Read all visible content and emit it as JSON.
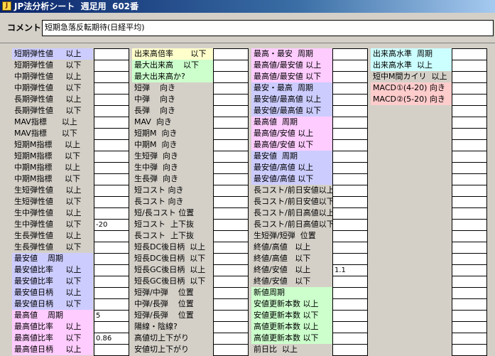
{
  "window": {
    "title": "JP法分析シート  週足用  602番"
  },
  "comment": {
    "label": "コメント",
    "value": "短期急落反転期待(日経平均)"
  },
  "columns": [
    {
      "rows": [
        {
          "label": "短期弾性値     以上",
          "value": "",
          "bg": "#ccccff"
        },
        {
          "label": "短期弾性値     以下",
          "value": "",
          "bg": ""
        },
        {
          "label": "中期弾性値     以上",
          "value": "",
          "bg": ""
        },
        {
          "label": "中期弾性値     以下",
          "value": "",
          "bg": ""
        },
        {
          "label": "長期弾性値     以上",
          "value": "",
          "bg": ""
        },
        {
          "label": "長期弾性値     以下",
          "value": "",
          "bg": ""
        },
        {
          "label": "MAV指標      以上",
          "value": "",
          "bg": ""
        },
        {
          "label": "MAV指標      以下",
          "value": "",
          "bg": ""
        },
        {
          "label": "短期M指標     以上",
          "value": "",
          "bg": ""
        },
        {
          "label": "短期M指標     以下",
          "value": "",
          "bg": ""
        },
        {
          "label": "中期M指標     以上",
          "value": "",
          "bg": ""
        },
        {
          "label": "中期M指標     以下",
          "value": "",
          "bg": ""
        },
        {
          "label": "生短弾性値     以上",
          "value": "",
          "bg": ""
        },
        {
          "label": "生短弾性値     以下",
          "value": "",
          "bg": ""
        },
        {
          "label": "生中弾性値     以上",
          "value": "",
          "bg": ""
        },
        {
          "label": "生中弾性値     以下",
          "value": "-20",
          "bg": ""
        },
        {
          "label": "生長弾性値     以上",
          "value": "",
          "bg": ""
        },
        {
          "label": "生長弾性値     以下",
          "value": "",
          "bg": ""
        },
        {
          "label": "最安値    周期",
          "value": "",
          "bg": "#ccccff"
        },
        {
          "label": "最安値比率     以上",
          "value": "",
          "bg": "#ccccff"
        },
        {
          "label": "最安値比率     以下",
          "value": "",
          "bg": "#ccccff"
        },
        {
          "label": "最安値日柄     以上",
          "value": "",
          "bg": "#ccccff"
        },
        {
          "label": "最安値日柄     以下",
          "value": "",
          "bg": "#ccccff"
        },
        {
          "label": "最高値    周期",
          "value": "5",
          "bg": "#ffccff"
        },
        {
          "label": "最高値比率     以上",
          "value": "",
          "bg": "#ffccff"
        },
        {
          "label": "最高値比率     以下",
          "value": "0.86",
          "bg": "#ffccff"
        },
        {
          "label": "最高値日柄     以上",
          "value": "",
          "bg": "#ffccff"
        }
      ]
    },
    {
      "rows": [
        {
          "label": "出来高倍率       以下",
          "value": "",
          "bg": "#ffffcc"
        },
        {
          "label": "最大出来高    以下",
          "value": "",
          "bg": "#ccffcc"
        },
        {
          "label": "最大出来高か?",
          "value": "",
          "bg": "#ccffcc"
        },
        {
          "label": "短弾    向き",
          "value": "",
          "bg": ""
        },
        {
          "label": "中弾    向き",
          "value": "",
          "bg": ""
        },
        {
          "label": "長弾    向き",
          "value": "",
          "bg": ""
        },
        {
          "label": "MAV  向き",
          "value": "",
          "bg": ""
        },
        {
          "label": "短期M  向き",
          "value": "",
          "bg": ""
        },
        {
          "label": "中期M  向き",
          "value": "",
          "bg": ""
        },
        {
          "label": "生短弾  向き",
          "value": "",
          "bg": ""
        },
        {
          "label": "生中弾  向き",
          "value": "",
          "bg": ""
        },
        {
          "label": "生長弾  向き",
          "value": "",
          "bg": ""
        },
        {
          "label": "短コスト 向き",
          "value": "",
          "bg": ""
        },
        {
          "label": "長コスト 向き",
          "value": "",
          "bg": ""
        },
        {
          "label": "短/長コスト 位置",
          "value": "",
          "bg": ""
        },
        {
          "label": "短コスト  上下抜",
          "value": "",
          "bg": ""
        },
        {
          "label": "長コスト  上下抜",
          "value": "",
          "bg": ""
        },
        {
          "label": "短長DC後日柄  以上",
          "value": "",
          "bg": ""
        },
        {
          "label": "短長DC後日柄  以下",
          "value": "",
          "bg": ""
        },
        {
          "label": "短長GC後日柄  以上",
          "value": "",
          "bg": ""
        },
        {
          "label": "短長GC後日柄  以下",
          "value": "",
          "bg": ""
        },
        {
          "label": "短弾/中弾    位置",
          "value": "",
          "bg": ""
        },
        {
          "label": "中弾/長弾    位置",
          "value": "",
          "bg": ""
        },
        {
          "label": "短弾/長弾    位置",
          "value": "",
          "bg": ""
        },
        {
          "label": "陽線・陰線?",
          "value": "",
          "bg": ""
        },
        {
          "label": "高値切上下がり",
          "value": "",
          "bg": ""
        },
        {
          "label": "安値切上下がり",
          "value": "",
          "bg": ""
        }
      ]
    },
    {
      "rows": [
        {
          "label": "最高・最安  周期",
          "value": "",
          "bg": "#ffccff"
        },
        {
          "label": "最高値/最安値 以上",
          "value": "",
          "bg": "#ffccff"
        },
        {
          "label": "最高値/最安値 以下",
          "value": "",
          "bg": "#ffccff"
        },
        {
          "label": "最安・最高  周期",
          "value": "",
          "bg": "#ccccff"
        },
        {
          "label": "最安値/最高値 以上",
          "value": "",
          "bg": "#ccccff"
        },
        {
          "label": "最安値/最高値 以下",
          "value": "",
          "bg": "#ccccff"
        },
        {
          "label": "最高値  周期",
          "value": "",
          "bg": "#ffccff"
        },
        {
          "label": "最高値/安値 以上",
          "value": "",
          "bg": "#ffccff"
        },
        {
          "label": "最高値/安値 以下",
          "value": "",
          "bg": "#ffccff"
        },
        {
          "label": "最安値  周期",
          "value": "",
          "bg": "#ccccff"
        },
        {
          "label": "最安値/高値 以上",
          "value": "",
          "bg": "#ccccff"
        },
        {
          "label": "最安値/高値 以下",
          "value": "",
          "bg": "#ccccff"
        },
        {
          "label": "長コスト/前日安値以上",
          "value": "",
          "bg": ""
        },
        {
          "label": "長コスト/前日安値以下",
          "value": "",
          "bg": ""
        },
        {
          "label": "長コスト/前日高値以上",
          "value": "",
          "bg": ""
        },
        {
          "label": "長コスト/前日高値以下",
          "value": "",
          "bg": ""
        },
        {
          "label": "生短弾/短弾  位置",
          "value": "",
          "bg": ""
        },
        {
          "label": "終値/高値   以上",
          "value": "",
          "bg": ""
        },
        {
          "label": "終値/高値   以下",
          "value": "",
          "bg": ""
        },
        {
          "label": "終値/安値   以上",
          "value": "1.1",
          "bg": ""
        },
        {
          "label": "終値/安値   以下",
          "value": "",
          "bg": ""
        },
        {
          "label": "新値周期",
          "value": "",
          "bg": "#ccffcc"
        },
        {
          "label": "安値更新本数 以上",
          "value": "",
          "bg": "#ccffcc"
        },
        {
          "label": "安値更新本数 以下",
          "value": "",
          "bg": "#ccffcc"
        },
        {
          "label": "高値更新本数 以上",
          "value": "",
          "bg": "#ccffcc"
        },
        {
          "label": "高値更新本数 以下",
          "value": "",
          "bg": "#ccffcc"
        },
        {
          "label": "前日比  以上",
          "value": "",
          "bg": ""
        }
      ]
    },
    {
      "rows": [
        {
          "label": "出来高水準  周期",
          "value": "",
          "bg": "#ccffff"
        },
        {
          "label": "出来高水準  以上",
          "value": "",
          "bg": "#ccffff"
        },
        {
          "label": "短中M間カイリ  以上",
          "value": "",
          "bg": ""
        },
        {
          "label": "MACD①(4-20) 向き",
          "value": "",
          "bg": "#ffcccc"
        },
        {
          "label": "MACD②(5-20) 向き",
          "value": "",
          "bg": "#ffcccc"
        },
        {
          "label": "",
          "value": "",
          "bg": ""
        },
        {
          "label": "",
          "value": "",
          "bg": ""
        },
        {
          "label": "",
          "value": "",
          "bg": ""
        },
        {
          "label": "",
          "value": "",
          "bg": ""
        },
        {
          "label": "",
          "value": "",
          "bg": ""
        },
        {
          "label": "",
          "value": "",
          "bg": ""
        },
        {
          "label": "",
          "value": "",
          "bg": ""
        },
        {
          "label": "",
          "value": "",
          "bg": ""
        },
        {
          "label": "",
          "value": "",
          "bg": ""
        },
        {
          "label": "",
          "value": "",
          "bg": ""
        },
        {
          "label": "",
          "value": "",
          "bg": ""
        },
        {
          "label": "",
          "value": "",
          "bg": ""
        },
        {
          "label": "",
          "value": "",
          "bg": ""
        },
        {
          "label": "",
          "value": "",
          "bg": ""
        },
        {
          "label": "",
          "value": "",
          "bg": ""
        },
        {
          "label": "",
          "value": "",
          "bg": ""
        },
        {
          "label": "",
          "value": "",
          "bg": ""
        },
        {
          "label": "",
          "value": "",
          "bg": ""
        },
        {
          "label": "",
          "value": "",
          "bg": ""
        },
        {
          "label": "",
          "value": "",
          "bg": ""
        },
        {
          "label": "",
          "value": "",
          "bg": ""
        },
        {
          "label": "",
          "value": "",
          "bg": ""
        }
      ]
    }
  ]
}
